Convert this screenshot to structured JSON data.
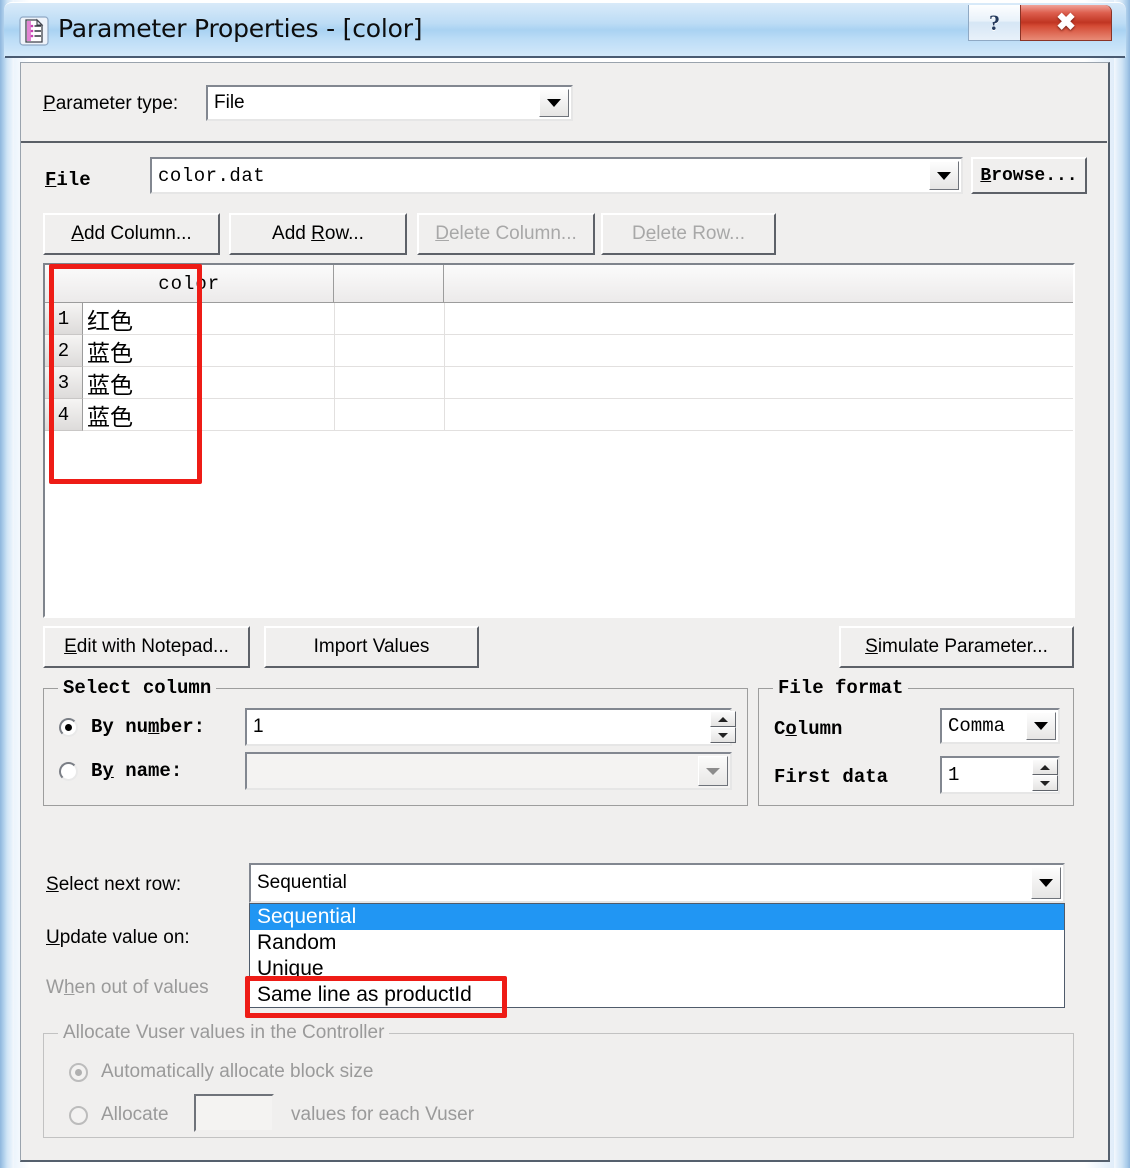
{
  "window": {
    "title": "Parameter Properties - [color]",
    "icon": "parameter-document-icon",
    "help_glyph": "?",
    "close_glyph": "✖"
  },
  "parameter_type": {
    "label": "Parameter type:",
    "label_accel": "P",
    "value": "File"
  },
  "file_row": {
    "label": "File",
    "value": "color.dat",
    "browse_label": "Browse..."
  },
  "grid_buttons": {
    "add_column": "Add Column...",
    "add_row": "Add Row...",
    "delete_column": "Delete Column...",
    "delete_row": "Delete Row..."
  },
  "table": {
    "columns": [
      "color",
      "",
      ""
    ],
    "rows": [
      {
        "num": "1",
        "value": "红色"
      },
      {
        "num": "2",
        "value": "蓝色"
      },
      {
        "num": "3",
        "value": "蓝色"
      },
      {
        "num": "4",
        "value": "蓝色"
      }
    ]
  },
  "action_buttons": {
    "edit_notepad": "Edit with Notepad...",
    "import_values": "Import Values",
    "simulate_parameter": "Simulate Parameter..."
  },
  "select_column": {
    "title": "Select column",
    "by_number_label": "By number:",
    "by_number_value": "1",
    "by_number_selected": true,
    "by_name_label": "By name:",
    "by_name_value": "",
    "by_name_selected": false
  },
  "file_format": {
    "title": "File format",
    "column_label": "Column",
    "column_value": "Comma",
    "first_data_label": "First data",
    "first_data_value": "1"
  },
  "next_row": {
    "label": "Select next row:",
    "value": "Sequential",
    "options": [
      "Sequential",
      "Random",
      "Unique",
      "Same line as productId"
    ],
    "selected_index": 0
  },
  "update_value": {
    "label": "Update value on:"
  },
  "out_of_values": {
    "label": "When out of values"
  },
  "allocate": {
    "title": "Allocate Vuser values in the Controller",
    "auto_label": "Automatically allocate block size",
    "auto_selected": true,
    "manual_label": "Allocate",
    "manual_value": "",
    "manual_suffix": "values for each Vuser",
    "manual_selected": false
  },
  "annotations": {
    "table_highlight": "red-box-around-color-column",
    "dropdown_highlight": "red-box-around-same-line-as-productId"
  },
  "colors": {
    "accent_blue": "#2196f3",
    "annotation_red": "#ee1c16",
    "dialog_face": "#f0efee"
  }
}
